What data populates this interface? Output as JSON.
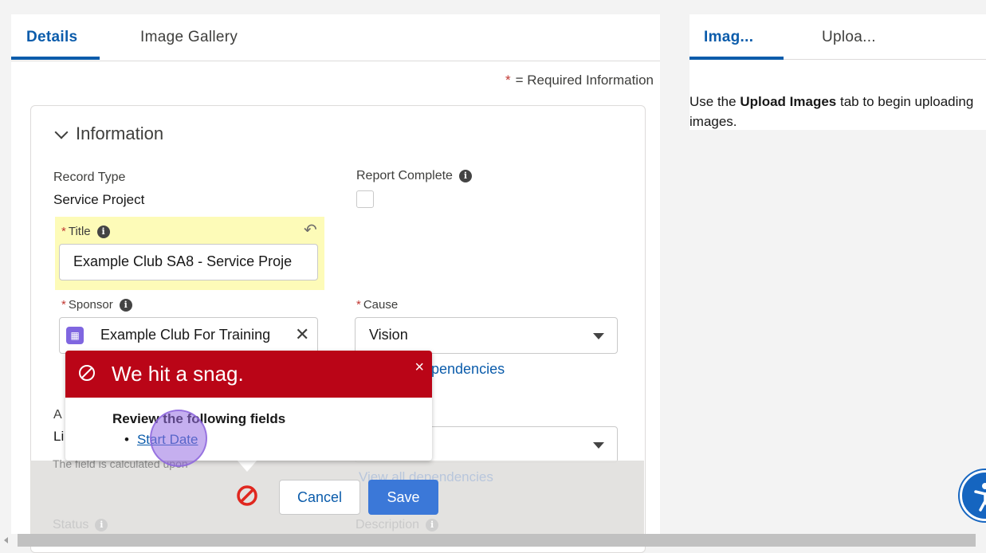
{
  "left_tabs": [
    "Details",
    "Image Gallery"
  ],
  "right_tabs": [
    "Imag...",
    "Uploa..."
  ],
  "required_note": {
    "star": "*",
    "text": "= Required Information"
  },
  "section": {
    "title": "Information"
  },
  "fields": {
    "record_type": {
      "label": "Record Type",
      "value": "Service Project"
    },
    "report_complete": {
      "label": "Report Complete",
      "checked": false
    },
    "title": {
      "required": "*",
      "label": "Title",
      "value": "Example Club SA8 - Service Proje"
    },
    "sponsor": {
      "required": "*",
      "label": "Sponsor",
      "value": "Example Club For Training"
    },
    "cause": {
      "required": "*",
      "label": "Cause",
      "value": "Vision",
      "dependencies_link": "pendencies"
    },
    "hidden_left": {
      "label_fragment": "A",
      "value_fragment": "Li",
      "help_fragment": "The field is calculated upon"
    },
    "second_dependencies_link": "View all dependencies",
    "status": {
      "label": "Status"
    },
    "description": {
      "label": "Description"
    }
  },
  "footer": {
    "cancel": "Cancel",
    "save": "Save"
  },
  "error_popover": {
    "title": "We hit a snag.",
    "close": "×",
    "subtitle": "Review the following fields",
    "fields": [
      "Start Date"
    ]
  },
  "right_panel": {
    "text_prefix": "Use the",
    "text_bold": "Upload Images",
    "text_suffix": "tab to begin uploading images."
  },
  "icons": {
    "info": "i",
    "undo": "↶",
    "clear": "✕",
    "lookup": "▦"
  },
  "colors": {
    "brand": "#0b5cab",
    "error": "#ba0517",
    "highlight": "#fdfbb8",
    "save": "#3b78d8"
  }
}
